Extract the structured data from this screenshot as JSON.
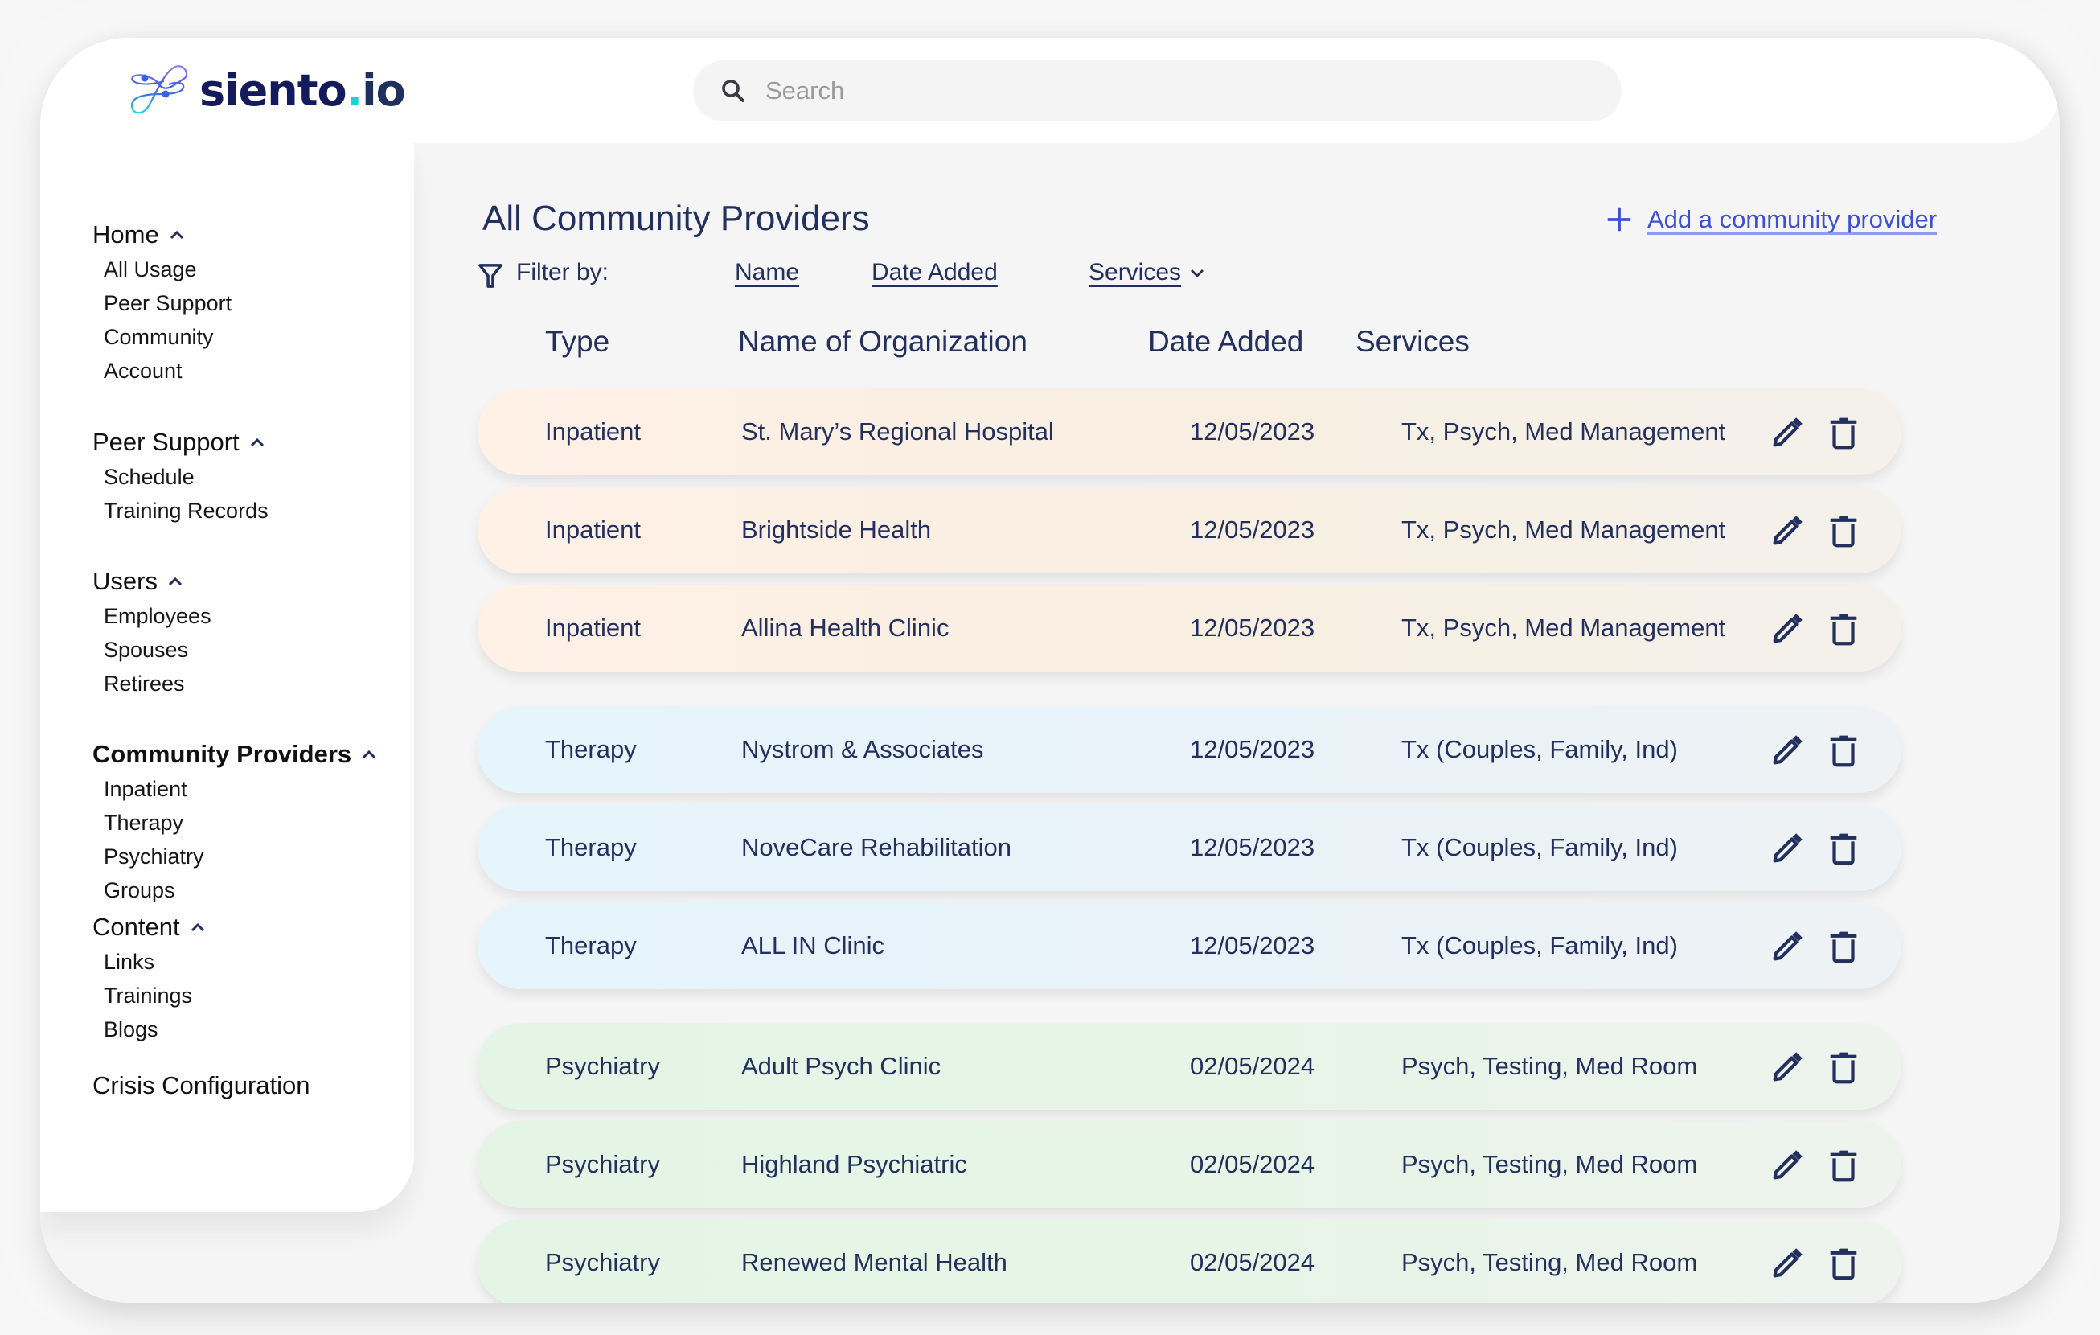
{
  "brand": {
    "name": "siento",
    "dot": ".",
    "tld": "io",
    "colors": {
      "primary": "#141b5c",
      "accent": "#1fd1d6"
    }
  },
  "search": {
    "placeholder": "Search",
    "value": "",
    "icon": "search-icon"
  },
  "sidebar": {
    "groups": [
      {
        "label": "Home",
        "expanded": true,
        "active": false,
        "items": [
          "All Usage",
          "Peer Support",
          "Community",
          "Account"
        ]
      },
      {
        "label": "Peer Support",
        "expanded": true,
        "active": false,
        "items": [
          "Schedule",
          "Training Records"
        ]
      },
      {
        "label": "Users",
        "expanded": true,
        "active": false,
        "items": [
          "Employees",
          "Spouses",
          "Retirees"
        ]
      },
      {
        "label": "Community Providers",
        "expanded": true,
        "active": true,
        "items": [
          "Inpatient",
          "Therapy",
          "Psychiatry",
          "Groups"
        ]
      },
      {
        "label": "Content",
        "expanded": true,
        "active": false,
        "items": [
          "Links",
          "Trainings",
          "Blogs"
        ]
      }
    ],
    "footer_item": "Crisis Configuration"
  },
  "main": {
    "title": "All Community Providers",
    "add_link": "Add a community provider",
    "filter": {
      "label": "Filter by:",
      "options": [
        "Name",
        "Date Added",
        "Services"
      ]
    },
    "columns": [
      "Type",
      "Name of Organization",
      "Date Added",
      "Services"
    ],
    "row_colors": {
      "Inpatient": "#fff1e6",
      "Therapy": "#e6f4fc",
      "Psychiatry": "#e4f5e6"
    },
    "rows": [
      {
        "type": "Inpatient",
        "name": "St. Mary’s Regional Hospital",
        "date": "12/05/2023",
        "services": "Tx, Psych, Med Management"
      },
      {
        "type": "Inpatient",
        "name": "Brightside Health",
        "date": "12/05/2023",
        "services": "Tx, Psych, Med Management"
      },
      {
        "type": "Inpatient",
        "name": "Allina Health Clinic",
        "date": "12/05/2023",
        "services": "Tx, Psych, Med Management"
      },
      {
        "type": "Therapy",
        "name": "Nystrom & Associates",
        "date": "12/05/2023",
        "services": "Tx (Couples, Family, Ind)"
      },
      {
        "type": "Therapy",
        "name": "NoveCare Rehabilitation",
        "date": "12/05/2023",
        "services": "Tx (Couples, Family, Ind)"
      },
      {
        "type": "Therapy",
        "name": "ALL IN Clinic",
        "date": "12/05/2023",
        "services": "Tx (Couples, Family, Ind)"
      },
      {
        "type": "Psychiatry",
        "name": "Adult Psych Clinic",
        "date": "02/05/2024",
        "services": "Psych, Testing, Med Room"
      },
      {
        "type": "Psychiatry",
        "name": "Highland Psychiatric",
        "date": "02/05/2024",
        "services": "Psych, Testing, Med Room"
      },
      {
        "type": "Psychiatry",
        "name": "Renewed Mental Health",
        "date": "02/05/2024",
        "services": "Psych, Testing, Med Room"
      }
    ]
  }
}
